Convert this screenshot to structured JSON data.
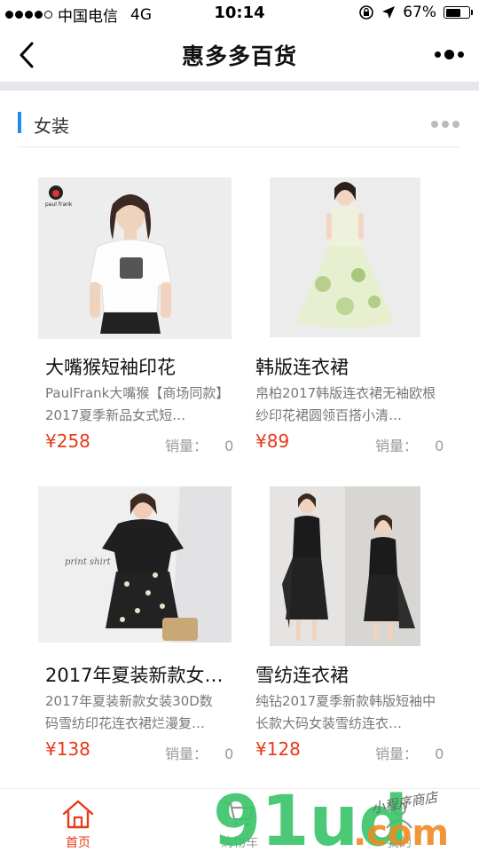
{
  "status_bar": {
    "carrier": "中国电信",
    "network": "4G",
    "time": "10:14",
    "battery": "67%",
    "battery_level": 0.67
  },
  "nav": {
    "title": "惠多多百货"
  },
  "section": {
    "title": "女装"
  },
  "products": [
    {
      "title": "大嘴猴短袖印花",
      "desc": "PaulFrank大嘴猴【商场同款】2017夏季新品女式短…",
      "price": "¥258",
      "sales_label": "销量：",
      "sales": "0",
      "image_logo": "paul frank"
    },
    {
      "title": "韩版连衣裙",
      "desc": "帛柏2017韩版连衣裙无袖欧根纱印花裙圆领百搭小清…",
      "price": "¥89",
      "sales_label": "销量：",
      "sales": "0"
    },
    {
      "title": "2017年夏装新款女…",
      "desc": "2017年夏装新款女装30D数码雪纺印花连衣裙烂漫复…",
      "price": "¥138",
      "sales_label": "销量：",
      "sales": "0",
      "image_text": "print shirt"
    },
    {
      "title": "雪纺连衣裙",
      "desc": "纯钻2017夏季新款韩版短袖中长款大码女装雪纺连衣…",
      "price": "¥128",
      "sales_label": "销量：",
      "sales": "0"
    }
  ],
  "tabs": [
    {
      "label": "首页",
      "icon": "home-icon",
      "active": true
    },
    {
      "label": "购物车",
      "icon": "cart-icon",
      "active": false
    },
    {
      "label": "我的",
      "icon": "user-icon",
      "active": false
    }
  ],
  "watermark": {
    "text": "91ud",
    "suffix": ".com",
    "tagline": "小程序商店"
  },
  "colors": {
    "accent_blue": "#1f8cf0",
    "price_red": "#e8391a",
    "watermark_green": "#3cc46a",
    "watermark_orange": "#f08a24"
  }
}
